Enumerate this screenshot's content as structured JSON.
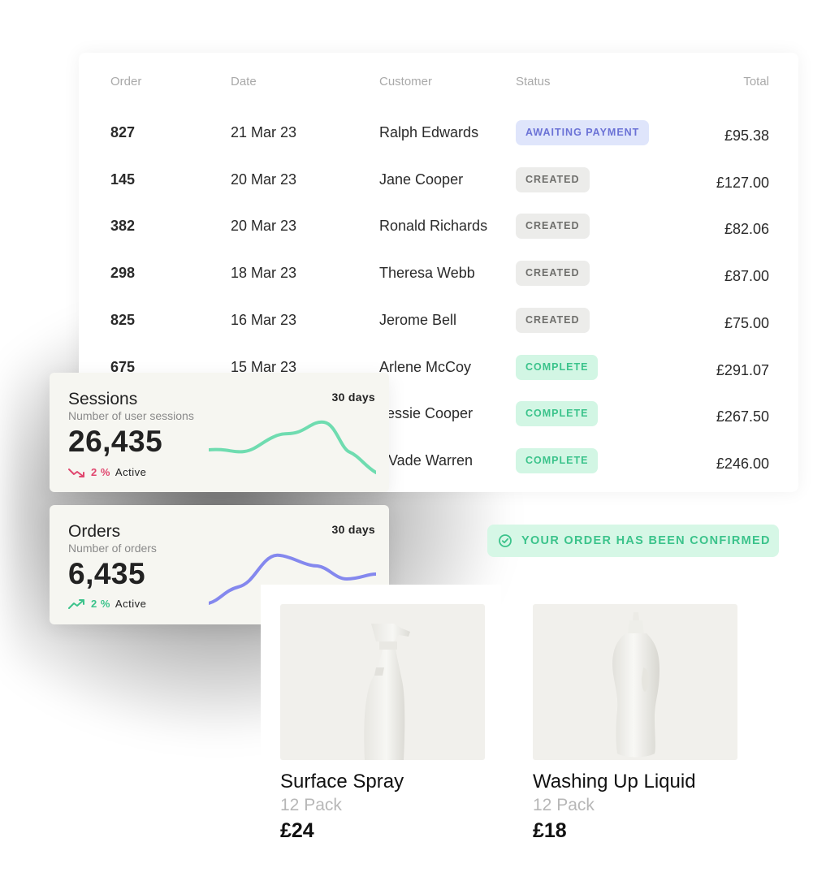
{
  "orders_table": {
    "headers": {
      "order": "Order",
      "date": "Date",
      "customer": "Customer",
      "status": "Status",
      "total": "Total"
    },
    "rows": [
      {
        "order": "827",
        "date": "21 Mar 23",
        "customer": "Ralph Edwards",
        "status": "AWAITING PAYMENT",
        "status_type": "awaiting",
        "total": "£95.38"
      },
      {
        "order": "145",
        "date": "20 Mar 23",
        "customer": "Jane Cooper",
        "status": "CREATED",
        "status_type": "created",
        "total": "£127.00"
      },
      {
        "order": "382",
        "date": "20 Mar 23",
        "customer": "Ronald Richards",
        "status": "CREATED",
        "status_type": "created",
        "total": "£82.06"
      },
      {
        "order": "298",
        "date": "18 Mar 23",
        "customer": "Theresa Webb",
        "status": "CREATED",
        "status_type": "created",
        "total": "£87.00"
      },
      {
        "order": "825",
        "date": "16 Mar 23",
        "customer": "Jerome Bell",
        "status": "CREATED",
        "status_type": "created",
        "total": "£75.00"
      },
      {
        "order": "675",
        "date": "15 Mar 23",
        "customer": "Arlene McCoy",
        "status": "COMPLETE",
        "status_type": "complete",
        "total": "£291.07"
      },
      {
        "order": "",
        "date": "",
        "customer": "essie Cooper",
        "status": "COMPLETE",
        "status_type": "complete",
        "total": "£267.50"
      },
      {
        "order": "",
        "date": "",
        "customer": "Vade Warren",
        "status": "COMPLETE",
        "status_type": "complete",
        "total": "£246.00"
      }
    ]
  },
  "sessions_card": {
    "title": "Sessions",
    "subtitle": "Number of user sessions",
    "value": "26,435",
    "range": "30 days",
    "trend_pct": "2 %",
    "trend_label": "Active",
    "trend_direction": "down",
    "trend_color": "#e0466e",
    "line_color": "#6fdcb0"
  },
  "orders_card": {
    "title": "Orders",
    "subtitle": "Number of orders",
    "value": "6,435",
    "range": "30 days",
    "trend_pct": "2 %",
    "trend_label": "Active",
    "trend_direction": "up",
    "trend_color": "#3bc38b",
    "line_color": "#8488ee"
  },
  "confirmation": {
    "text": "YOUR ORDER HAS BEEN CONFIRMED",
    "icon": "check-circle-icon"
  },
  "products": [
    {
      "name": "Surface Spray",
      "pack": "12 Pack",
      "price": "£24",
      "image": "spray-bottle"
    },
    {
      "name": "Washing Up Liquid",
      "pack": "12 Pack",
      "price": "£18",
      "image": "detergent-bottle"
    }
  ],
  "colors": {
    "awaiting_bg": "#dfe5fb",
    "awaiting_fg": "#6b72d6",
    "created_bg": "#ececea",
    "created_fg": "#6f6f6c",
    "complete_bg": "#d2f6e4",
    "complete_fg": "#3bc38b"
  }
}
